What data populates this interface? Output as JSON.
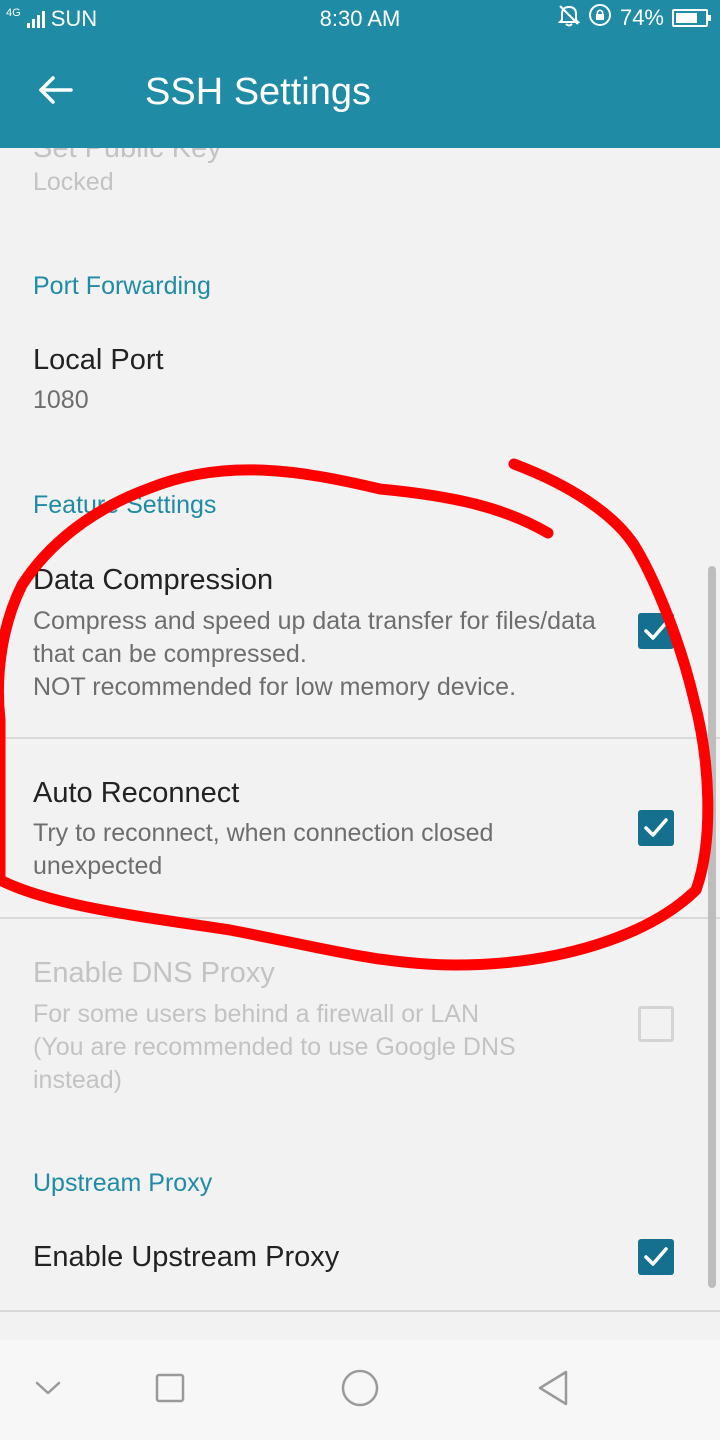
{
  "status_bar": {
    "network_badge": "4G",
    "carrier": "SUN",
    "time": "8:30 AM",
    "battery_percent_label": "74%",
    "battery_level": 0.74
  },
  "app_bar": {
    "title": "SSH Settings"
  },
  "prefs": {
    "public_key": {
      "title": "Set Public Key",
      "summary": "Locked"
    },
    "port_forwarding_header": "Port Forwarding",
    "local_port": {
      "title": "Local Port",
      "summary": "1080"
    },
    "feature_settings_header": "Feature Settings",
    "data_compression": {
      "title": "Data Compression",
      "summary": "Compress and speed up data transfer for files/data that can be compressed.\nNOT recommended for low memory device.",
      "checked": true
    },
    "auto_reconnect": {
      "title": "Auto Reconnect",
      "summary": "Try to reconnect, when connection closed unexpected",
      "checked": true
    },
    "dns_proxy": {
      "title": "Enable DNS Proxy",
      "summary": "For some users behind a firewall or LAN\n(You are recommended to use Google DNS instead)",
      "checked": false,
      "enabled": false
    },
    "upstream_proxy_header": "Upstream Proxy",
    "upstream_proxy": {
      "title": "Enable Upstream Proxy",
      "checked": true
    }
  },
  "colors": {
    "accent": "#1f8ba5",
    "checkbox": "#156f8e",
    "annotation": "#ff0000"
  },
  "icons": {
    "back": "arrow-left-icon",
    "nav_down": "chevron-down-icon",
    "nav_recents": "square-icon",
    "nav_home": "circle-icon",
    "nav_back": "triangle-back-icon"
  }
}
